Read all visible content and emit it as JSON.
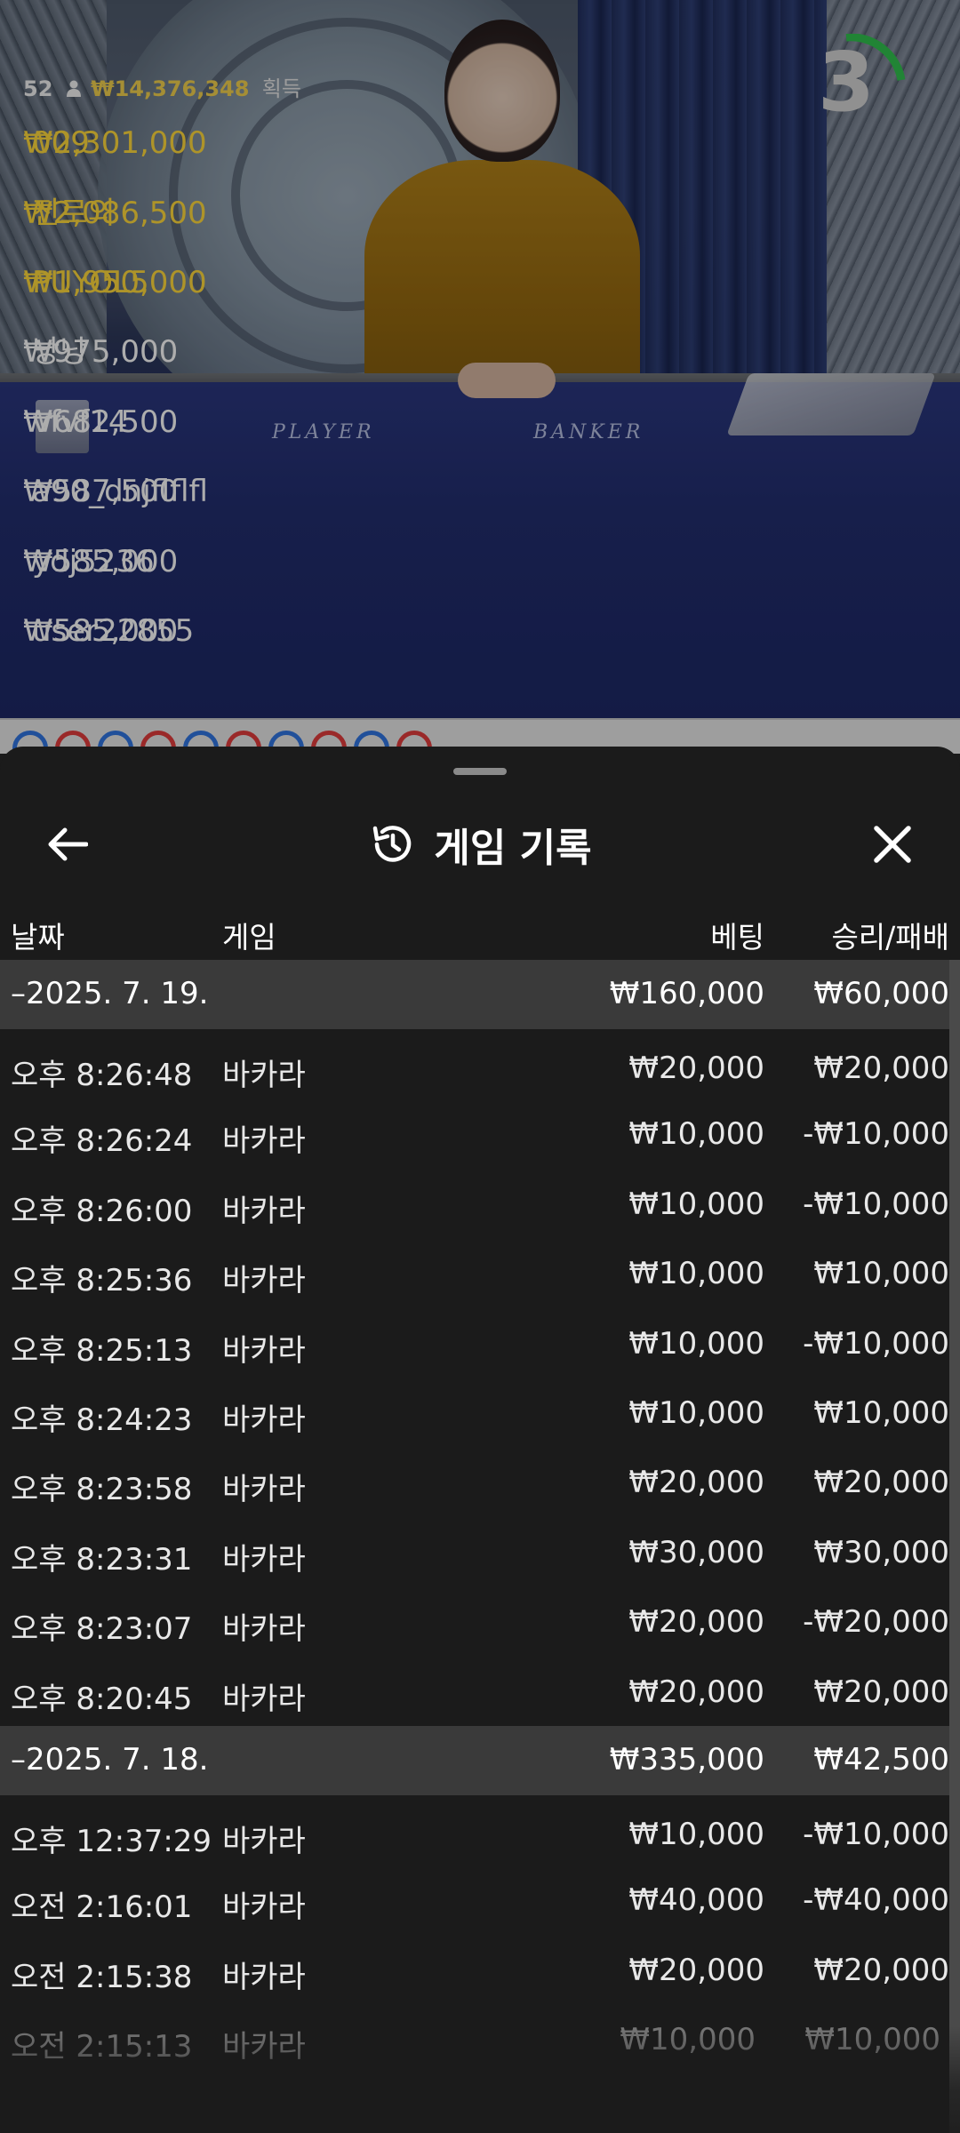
{
  "stream": {
    "felt_player": "PLAYER",
    "felt_banker": "BANKER",
    "countdown": "3",
    "leaderboard": {
      "count": "52",
      "total": "₩14,376,348",
      "suffix": "획득",
      "entries": [
        {
          "amount": "₩2,301,000",
          "name": "009"
        },
        {
          "amount": "₩2,086,500",
          "name": "진로의"
        },
        {
          "amount": "₩1,950,000",
          "name": "PUYOL5"
        },
        {
          "amount": "₩975,000",
          "name": "낭낭"
        },
        {
          "amount": "₩682,500",
          "name": "vfvf14"
        },
        {
          "amount": "₩587,500",
          "name": "a90_dnjflflfl"
        },
        {
          "amount": "₩585,000",
          "name": "ydj5236"
        },
        {
          "amount": "₩585,000",
          "name": "user22855"
        }
      ]
    }
  },
  "sheet": {
    "title": "게임 기록",
    "columns": {
      "date": "날짜",
      "game": "게임",
      "bet": "베팅",
      "winloss": "승리/패배"
    },
    "groups": [
      {
        "date": "–2025. 7. 19.",
        "bet_total": "₩160,000",
        "win_total": "₩60,000",
        "rows": [
          {
            "time": "오후 8:26:48",
            "game": "바카라",
            "bet": "₩20,000",
            "result": "₩20,000"
          },
          {
            "time": "오후 8:26:24",
            "game": "바카라",
            "bet": "₩10,000",
            "result": "-₩10,000"
          },
          {
            "time": "오후 8:26:00",
            "game": "바카라",
            "bet": "₩10,000",
            "result": "-₩10,000"
          },
          {
            "time": "오후 8:25:36",
            "game": "바카라",
            "bet": "₩10,000",
            "result": "₩10,000"
          },
          {
            "time": "오후 8:25:13",
            "game": "바카라",
            "bet": "₩10,000",
            "result": "-₩10,000"
          },
          {
            "time": "오후 8:24:23",
            "game": "바카라",
            "bet": "₩10,000",
            "result": "₩10,000"
          },
          {
            "time": "오후 8:23:58",
            "game": "바카라",
            "bet": "₩20,000",
            "result": "₩20,000"
          },
          {
            "time": "오후 8:23:31",
            "game": "바카라",
            "bet": "₩30,000",
            "result": "₩30,000"
          },
          {
            "time": "오후 8:23:07",
            "game": "바카라",
            "bet": "₩20,000",
            "result": "-₩20,000"
          },
          {
            "time": "오후 8:20:45",
            "game": "바카라",
            "bet": "₩20,000",
            "result": "₩20,000"
          }
        ]
      },
      {
        "date": "–2025. 7. 18.",
        "bet_total": "₩335,000",
        "win_total": "₩42,500",
        "rows": [
          {
            "time": "오후 12:37:29",
            "game": "바카라",
            "bet": "₩10,000",
            "result": "-₩10,000"
          },
          {
            "time": "오전 2:16:01",
            "game": "바카라",
            "bet": "₩40,000",
            "result": "-₩40,000"
          },
          {
            "time": "오전 2:15:38",
            "game": "바카라",
            "bet": "₩20,000",
            "result": "₩20,000"
          },
          {
            "time": "오전 2:15:13",
            "game": "바카라",
            "bet": "₩10,000",
            "result": "₩10,000"
          }
        ]
      }
    ]
  },
  "colors": {
    "sheet_bg": "#1b1b1b",
    "date_row_bg": "#3a3a3a",
    "gold": "#f2cd3a",
    "timer_arc": "#2fb84a",
    "road_blue": "#2f6fd6",
    "road_red": "#d63a3a"
  },
  "icons": [
    "back-arrow-icon",
    "history-icon",
    "close-icon",
    "user-icon"
  ]
}
